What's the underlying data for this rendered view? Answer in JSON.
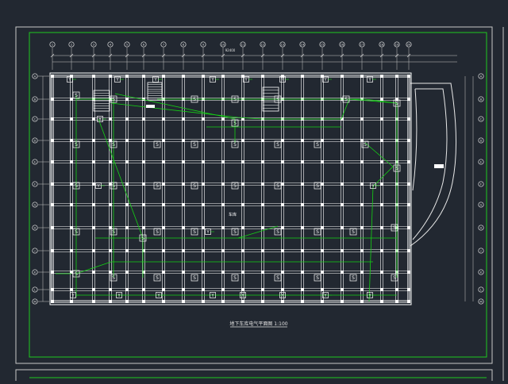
{
  "drawing": {
    "title": "地下车库电气平面图  1:100",
    "room_label": "车库",
    "dim_total": "92400",
    "x_axis_labels": [
      "1",
      "2",
      "3",
      "4",
      "5",
      "6",
      "7",
      "8",
      "9",
      "10",
      "11",
      "12",
      "13",
      "14",
      "15",
      "16",
      "17",
      "18",
      "19",
      "20"
    ],
    "y_axis_labels": [
      "A",
      "B",
      "C",
      "D",
      "E",
      "F",
      "G",
      "H",
      "J",
      "K",
      "L",
      "M"
    ],
    "colors": {
      "background": "#222831",
      "frame": "#d0d0d0",
      "border_green": "#1ec81e",
      "structure": "#ffffff",
      "wiring": "#14d214",
      "text": "#e0e0e0"
    },
    "symbols": {
      "fixture": "S",
      "outlet": "Y"
    }
  }
}
